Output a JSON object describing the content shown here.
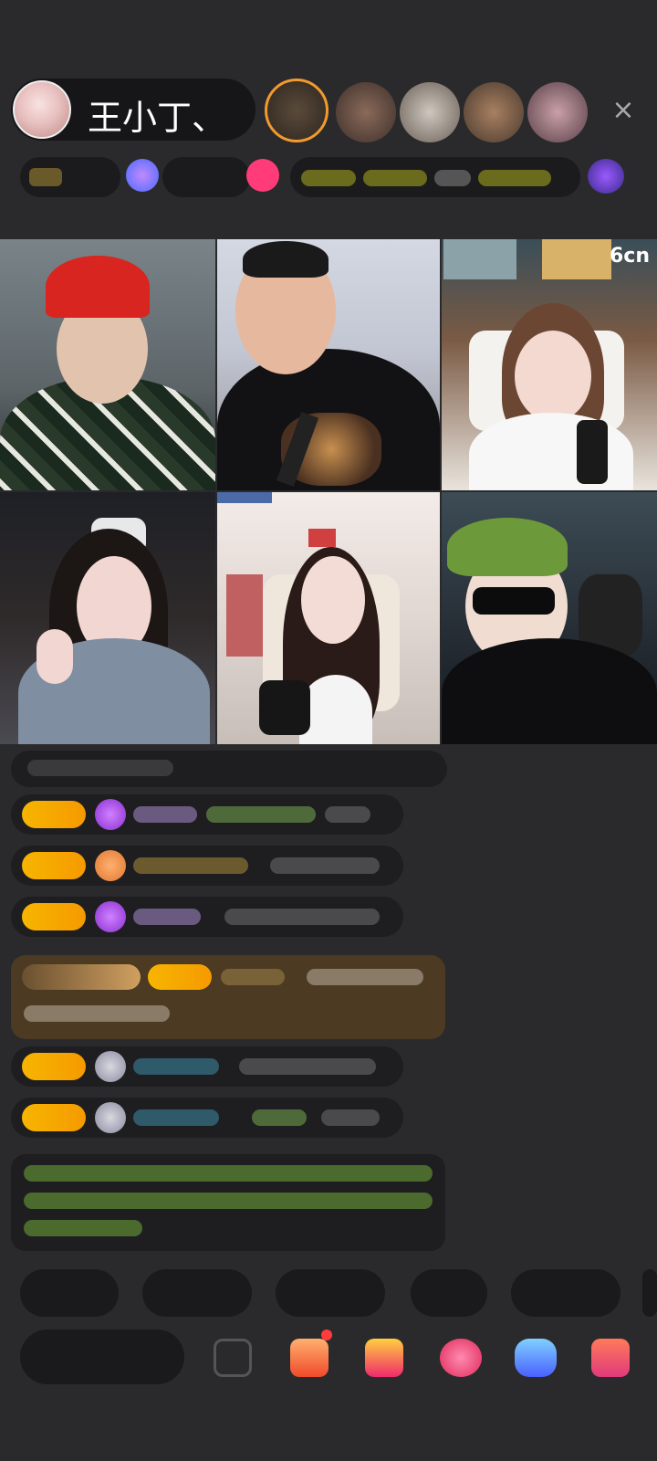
{
  "host": {
    "name": "王小丁、"
  },
  "watermark": "6cn",
  "header": {
    "close_label": "×"
  }
}
